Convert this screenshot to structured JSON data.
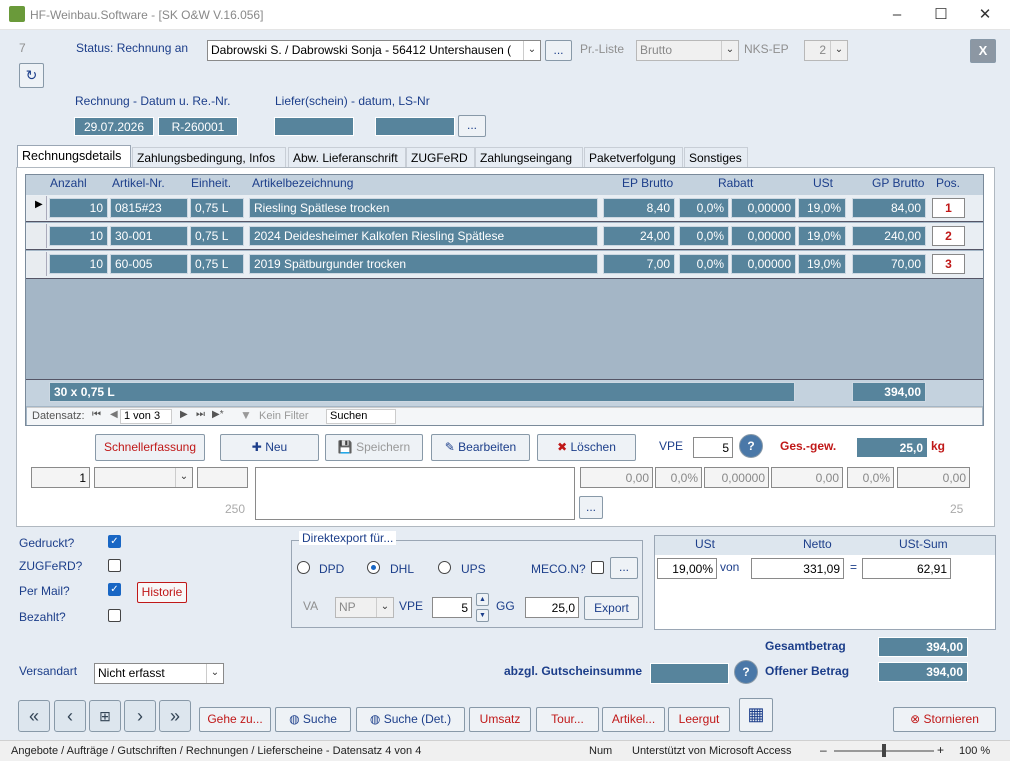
{
  "window": {
    "title": "HF-Weinbau.Software - [SK O&W V.16.056]"
  },
  "record_no": "7",
  "customer": {
    "label": "Status: Rechnung an",
    "value": "Dabrowski S. / Dabrowski Sonja - 56412 Untershausen (",
    "price_list_label": "Pr.-Liste",
    "price_list_value": "Brutto",
    "nks_label": "NKS-EP",
    "nks_value": "2"
  },
  "invoice": {
    "label": "Rechnung - Datum u. Re.-Nr.",
    "date": "29.07.2026",
    "number": "R-260001",
    "delivery_label": "Liefer(schein) - datum, LS-Nr"
  },
  "tabs": [
    "Rechnungsdetails",
    "Zahlungsbedingung, Infos",
    "Abw. Lieferanschrift",
    "ZUGFeRD",
    "Zahlungseingang",
    "Paketverfolgung",
    "Sonstiges"
  ],
  "columns": [
    "Anzahl",
    "Artikel-Nr.",
    "Einheit.",
    "Artikelbezeichnung",
    "EP Brutto",
    "Rabatt",
    "USt",
    "GP Brutto",
    "Pos."
  ],
  "rows": [
    {
      "qty": "10",
      "art": "0815#23",
      "unit": "0,75 L",
      "name": "Riesling Spätlese trocken",
      "ep": "8,40",
      "rabatt": "0,0%",
      "rabatt2": "0,00000",
      "ust": "19,0%",
      "gp": "84,00",
      "pos": "1"
    },
    {
      "qty": "10",
      "art": "30-001",
      "unit": "0,75 L",
      "name": "2024 Deidesheimer Kalkofen Riesling Spätlese",
      "ep": "24,00",
      "rabatt": "0,0%",
      "rabatt2": "0,00000",
      "ust": "19,0%",
      "gp": "240,00",
      "pos": "2"
    },
    {
      "qty": "10",
      "art": "60-005",
      "unit": "0,75 L",
      "name": "2019 Spätburgunder trocken",
      "ep": "7,00",
      "rabatt": "0,0%",
      "rabatt2": "0,00000",
      "ust": "19,0%",
      "gp": "70,00",
      "pos": "3"
    }
  ],
  "totals_row": {
    "summary": "30 x 0,75 L",
    "sum": "394,00"
  },
  "navigator": {
    "label": "Datensatz:",
    "position": "1 von 3",
    "filter": "Kein Filter",
    "search": "Suchen"
  },
  "actions": {
    "quick": "Schnellerfassung",
    "new": "Neu",
    "save": "Speichern",
    "edit": "Bearbeiten",
    "delete": "Löschen",
    "vpe_label": "VPE",
    "vpe_value": "5",
    "weight_label": "Ges.-gew.",
    "weight_value": "25,0",
    "weight_unit": "kg"
  },
  "entry": {
    "qty": "1",
    "chars_left": "250",
    "ep": "0,00",
    "rabatt": "0,0%",
    "rabatt2": "0,00000",
    "ust": "0,00",
    "ust_pct": "0,0%",
    "gp": "0,00",
    "pos_max": "25"
  },
  "flags": {
    "printed": "Gedruckt?",
    "zugferd": "ZUGFeRD?",
    "mail": "Per Mail?",
    "paid": "Bezahlt?",
    "history": "Historie"
  },
  "export": {
    "title": "Direktexport für...",
    "dpd": "DPD",
    "dhl": "DHL",
    "ups": "UPS",
    "meco": "MECO.N?",
    "va_label": "VA",
    "va_value": "NP",
    "vpe_label": "VPE",
    "vpe_value": "5",
    "gg_label": "GG",
    "gg_value": "25,0",
    "button": "Export"
  },
  "vat": {
    "h_ust": "USt",
    "h_netto": "Netto",
    "h_sum": "USt-Sum",
    "rate": "19,00%",
    "von": "von",
    "netto": "331,09",
    "eq": "=",
    "sum": "62,91"
  },
  "summary": {
    "total_label": "Gesamtbetrag",
    "total": "394,00",
    "voucher_label": "abzgl. Gutscheinsumme",
    "open_label": "Offener Betrag",
    "open": "394,00"
  },
  "shipping": {
    "label": "Versandart",
    "value": "Nicht erfasst"
  },
  "bottom_buttons": {
    "goto": "Gehe zu...",
    "search": "Suche",
    "search_det": "Suche (Det.)",
    "sales": "Umsatz",
    "tour": "Tour...",
    "article": "Artikel...",
    "empties": "Leergut",
    "cancel": "Stornieren",
    "close": "X"
  },
  "statusbar": {
    "left": "Angebote / Aufträge / Gutschriften / Rechnungen / Lieferscheine - Datensatz 4 von 4",
    "num": "Num",
    "support": "Unterstützt von Microsoft Access",
    "zoom": "100 %"
  }
}
